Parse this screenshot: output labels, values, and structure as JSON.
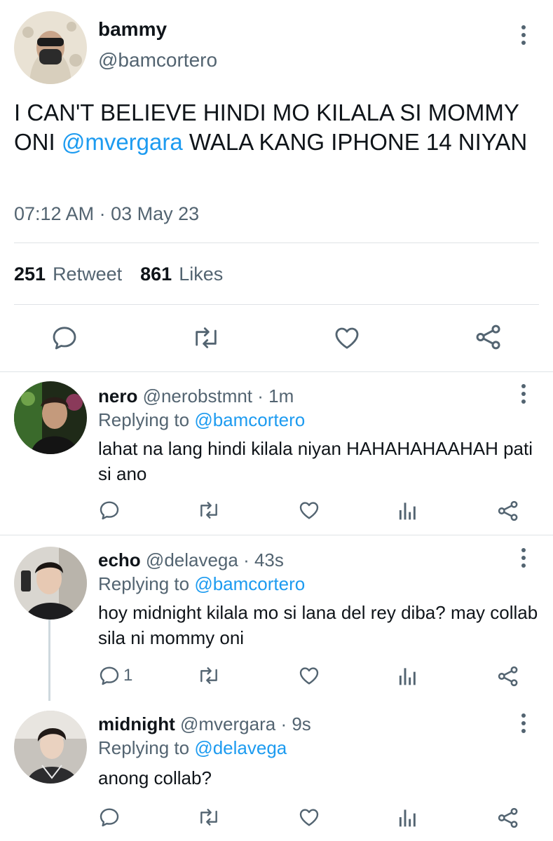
{
  "colors": {
    "text": "#0f1419",
    "secondary": "#536471",
    "link": "#1d9bf0",
    "divider": "#dfe3e6",
    "thread_line": "#cfd9de"
  },
  "main_tweet": {
    "name": "bammy",
    "handle": "@bamcortero",
    "text_part1": "I CAN'T BELIEVE HINDI MO KILALA SI MOMMY ONI ",
    "mention": "@mvergara",
    "text_part2": " WALA KANG IPHONE 14 NIYAN",
    "timestamp": "07:12 AM · 03 May 23",
    "retweet_count": "251",
    "retweet_label": "Retweet",
    "like_count": "861",
    "like_label": "Likes",
    "icons": [
      "comment-icon",
      "retweet-icon",
      "heart-icon",
      "share-icon",
      "more-icon"
    ]
  },
  "replies": [
    {
      "name": "nero",
      "handle": "@nerobstmnt",
      "time": "1m",
      "replying_label": "Replying to",
      "replying_to": "@bamcortero",
      "text": "lahat na lang hindi kilala niyan HAHAHAHAAHAH pati si ano",
      "reply_count": ""
    },
    {
      "name": "echo",
      "handle": "@delavega",
      "time": "43s",
      "replying_label": "Replying to",
      "replying_to": "@bamcortero",
      "text": "hoy midnight kilala mo si lana del rey diba? may collab sila ni mommy oni",
      "reply_count": "1"
    },
    {
      "name": "midnight",
      "handle": "@mvergara",
      "time": "9s",
      "replying_label": "Replying to",
      "replying_to": "@delavega",
      "text": "anong collab?",
      "reply_count": ""
    }
  ]
}
